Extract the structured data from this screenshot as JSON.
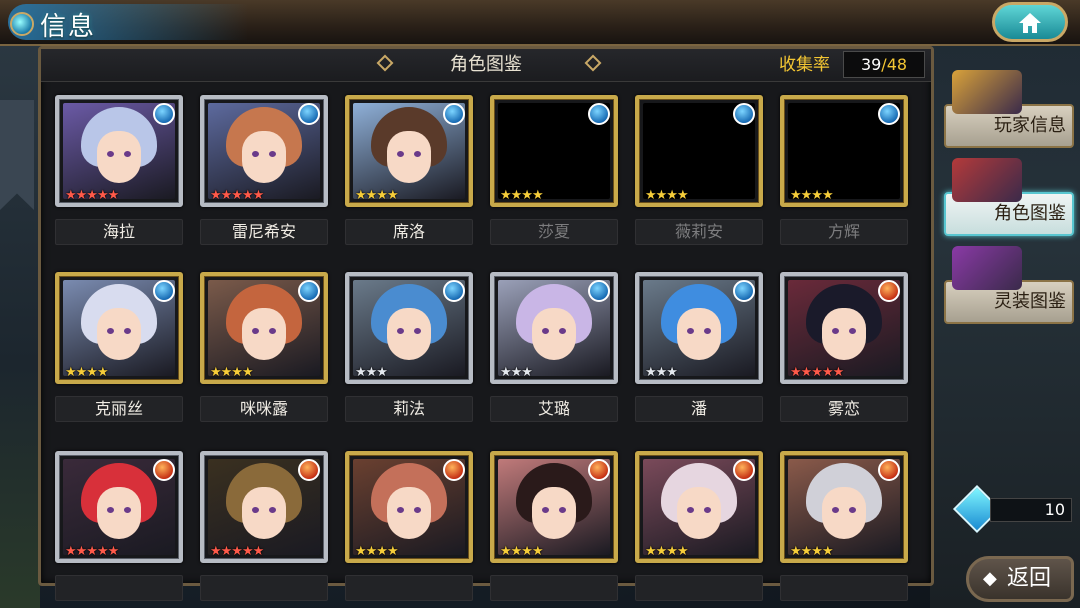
{
  "header": {
    "title": "信息"
  },
  "panel": {
    "title": "角色图鉴",
    "collection_label": "收集率",
    "collected": "39",
    "separator": "/",
    "total": "48"
  },
  "rows": [
    {
      "cards": [
        {
          "name": "海拉",
          "element": "water",
          "stars": "★★★★★",
          "star_color": "red",
          "frame": "silver",
          "locked": false,
          "hair": "#b9c6e8",
          "bg": "#6b5aa6"
        },
        {
          "name": "雷尼希安",
          "element": "water",
          "stars": "★★★★★",
          "star_color": "red",
          "frame": "silver",
          "locked": false,
          "hair": "#c6774e",
          "bg": "#5d6a9e"
        },
        {
          "name": "席洛",
          "element": "water",
          "stars": "★★★★",
          "star_color": "gold",
          "frame": "gold",
          "locked": false,
          "hair": "#5a3a2a",
          "bg": "#8fb0d8"
        },
        {
          "name": "莎夏",
          "element": "water",
          "stars": "★★★★",
          "star_color": "gold",
          "frame": "gold",
          "locked": true,
          "hair": "#000",
          "bg": "#3a2e1a"
        },
        {
          "name": "薇莉安",
          "element": "water",
          "stars": "★★★★",
          "star_color": "gold",
          "frame": "gold",
          "locked": true,
          "hair": "#000",
          "bg": "#3a2e1a"
        },
        {
          "name": "方辉",
          "element": "water",
          "stars": "★★★★",
          "star_color": "gold",
          "frame": "gold",
          "locked": true,
          "hair": "#000",
          "bg": "#3a2e1a"
        }
      ]
    },
    {
      "cards": [
        {
          "name": "克丽丝",
          "element": "water",
          "stars": "★★★★",
          "star_color": "gold",
          "frame": "gold",
          "locked": false,
          "hair": "#d8dcef",
          "bg": "#7a8bb0"
        },
        {
          "name": "咪咪露",
          "element": "water",
          "stars": "★★★★",
          "star_color": "gold",
          "frame": "gold",
          "locked": false,
          "hair": "#c4653e",
          "bg": "#7a5a4a"
        },
        {
          "name": "莉法",
          "element": "water",
          "stars": "★★★",
          "star_color": "silver",
          "frame": "silver",
          "locked": false,
          "hair": "#4a8cd0",
          "bg": "#6a7a8a"
        },
        {
          "name": "艾璐",
          "element": "water",
          "stars": "★★★",
          "star_color": "silver",
          "frame": "silver",
          "locked": false,
          "hair": "#c9b6e6",
          "bg": "#9aa0b8"
        },
        {
          "name": "潘",
          "element": "water",
          "stars": "★★★",
          "star_color": "silver",
          "frame": "silver",
          "locked": false,
          "hair": "#3f8de0",
          "bg": "#6a7a8a"
        },
        {
          "name": "雾恋",
          "element": "fire",
          "stars": "★★★★★",
          "star_color": "red",
          "frame": "silver",
          "locked": false,
          "hair": "#1a1a2a",
          "bg": "#6a2a3a"
        }
      ]
    },
    {
      "cards": [
        {
          "name": "",
          "element": "fire",
          "stars": "★★★★★",
          "star_color": "red",
          "frame": "silver",
          "locked": false,
          "hair": "#d8303a",
          "bg": "#3a2a3a"
        },
        {
          "name": "",
          "element": "fire",
          "stars": "★★★★★",
          "star_color": "red",
          "frame": "silver",
          "locked": false,
          "hair": "#8a6a3a",
          "bg": "#3a3020"
        },
        {
          "name": "",
          "element": "fire",
          "stars": "★★★★",
          "star_color": "gold",
          "frame": "gold",
          "locked": false,
          "hair": "#c4705a",
          "bg": "#6a4030"
        },
        {
          "name": "",
          "element": "fire",
          "stars": "★★★★",
          "star_color": "gold",
          "frame": "gold",
          "locked": false,
          "hair": "#2a1a1a",
          "bg": "#c07a7a"
        },
        {
          "name": "",
          "element": "fire",
          "stars": "★★★★",
          "star_color": "gold",
          "frame": "gold",
          "locked": false,
          "hair": "#e6d6e0",
          "bg": "#7a4a5a"
        },
        {
          "name": "",
          "element": "fire",
          "stars": "★★★★",
          "star_color": "gold",
          "frame": "gold",
          "locked": false,
          "hair": "#d0d0d8",
          "bg": "#8a5a4a"
        }
      ]
    }
  ],
  "side_menu": [
    {
      "label": "玩家信息",
      "active": false,
      "icon_color": "#d9a23a"
    },
    {
      "label": "角色图鉴",
      "active": true,
      "icon_color": "#b43a3a"
    },
    {
      "label": "灵装图鉴",
      "active": false,
      "icon_color": "#8a3aa6"
    }
  ],
  "currency": {
    "icon": "crystal-icon",
    "amount": "10"
  },
  "back": {
    "arrow": "◆",
    "label": "返回"
  },
  "element_glyphs": {
    "water": "💧",
    "fire": "🔥"
  }
}
